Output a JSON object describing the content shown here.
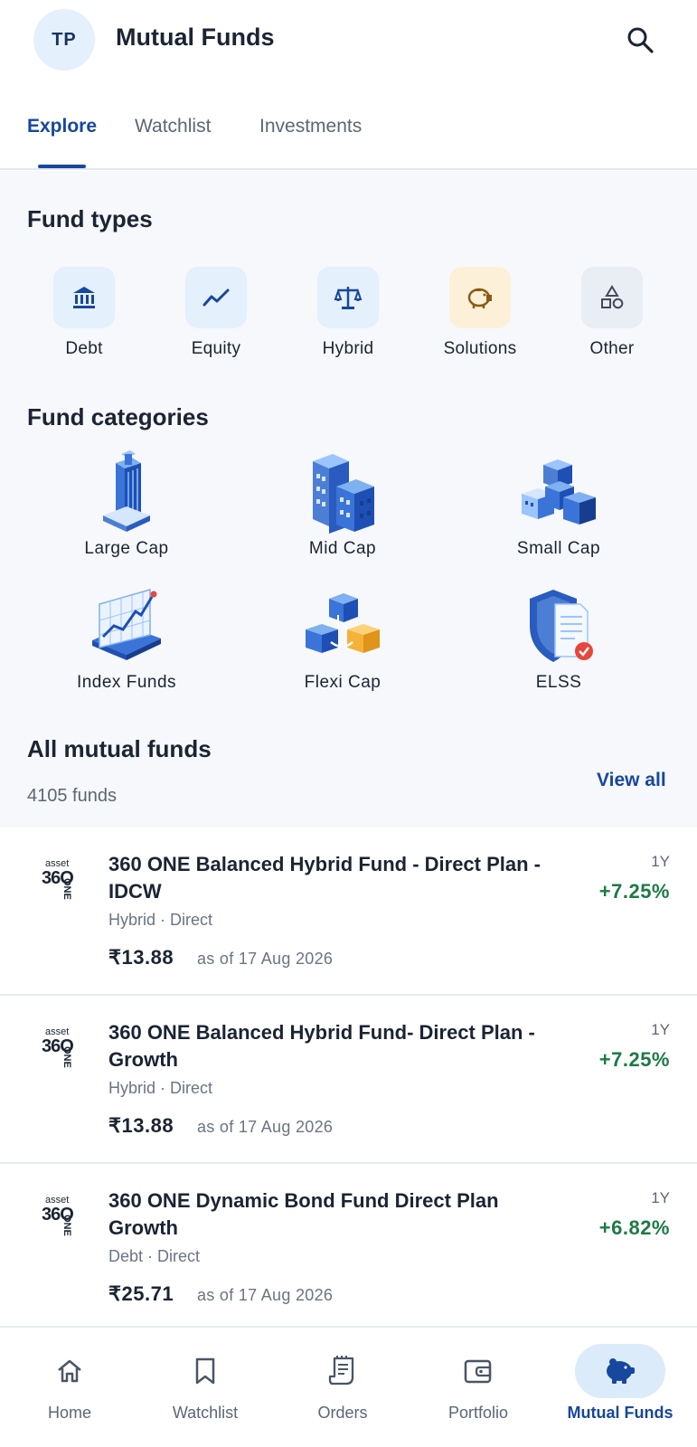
{
  "header": {
    "avatar_initials": "TP",
    "title": "Mutual Funds",
    "search_icon": "search-icon"
  },
  "tabs": [
    {
      "label": "Explore",
      "active": true
    },
    {
      "label": "Watchlist",
      "active": false
    },
    {
      "label": "Investments",
      "active": false
    }
  ],
  "fund_types": {
    "title": "Fund types",
    "items": [
      {
        "label": "Debt",
        "icon": "bank-icon",
        "bg": "#e4f0fc",
        "color": "#17479e"
      },
      {
        "label": "Equity",
        "icon": "trend-line-icon",
        "bg": "#e4f0fc",
        "color": "#17479e"
      },
      {
        "label": "Hybrid",
        "icon": "scales-icon",
        "bg": "#e4f0fc",
        "color": "#17479e"
      },
      {
        "label": "Solutions",
        "icon": "piggy-bank-icon",
        "bg": "#fdf0d8",
        "color": "#8a5a16"
      },
      {
        "label": "Other",
        "icon": "shapes-icon",
        "bg": "#e9edf4",
        "color": "#404a5a"
      }
    ]
  },
  "fund_categories": {
    "title": "Fund categories",
    "items": [
      {
        "label": "Large Cap",
        "icon": "skyscraper-icon"
      },
      {
        "label": "Mid Cap",
        "icon": "buildings-icon"
      },
      {
        "label": "Small Cap",
        "icon": "cubes-icon"
      },
      {
        "label": "Index Funds",
        "icon": "chart-board-icon"
      },
      {
        "label": "Flexi Cap",
        "icon": "connected-blocks-icon"
      },
      {
        "label": "ELSS",
        "icon": "shield-document-icon"
      }
    ]
  },
  "all_funds": {
    "title": "All mutual funds",
    "count": "4105 funds",
    "view_all": "View all",
    "items": [
      {
        "logo_top": "asset",
        "logo_main": "36O",
        "logo_side": "ONE",
        "name": "360 ONE Balanced Hybrid Fund - Direct Plan - IDCW",
        "meta": "Hybrid · Direct",
        "price": "₹13.88",
        "as_of": "as of 17 Aug 2026",
        "period": "1Y",
        "return": "+7.25%"
      },
      {
        "logo_top": "asset",
        "logo_main": "36O",
        "logo_side": "ONE",
        "name": "360 ONE Balanced Hybrid Fund- Direct Plan - Growth",
        "meta": "Hybrid · Direct",
        "price": "₹13.88",
        "as_of": "as of 17 Aug 2026",
        "period": "1Y",
        "return": "+7.25%"
      },
      {
        "logo_top": "asset",
        "logo_main": "36O",
        "logo_side": "ONE",
        "name": "360 ONE Dynamic Bond Fund Direct Plan Growth",
        "meta": "Debt · Direct",
        "price": "₹25.71",
        "as_of": "as of 17 Aug 2026",
        "period": "1Y",
        "return": "+6.82%"
      }
    ]
  },
  "bottom_nav": [
    {
      "label": "Home",
      "icon": "home-icon",
      "active": false
    },
    {
      "label": "Watchlist",
      "icon": "bookmark-icon",
      "active": false
    },
    {
      "label": "Orders",
      "icon": "receipt-icon",
      "active": false
    },
    {
      "label": "Portfolio",
      "icon": "wallet-icon",
      "active": false
    },
    {
      "label": "Mutual Funds",
      "icon": "piggy-bank-icon",
      "active": true
    }
  ],
  "colors": {
    "accent": "#17479e",
    "positive": "#1c7a45",
    "section_bg": "#f6f8fb"
  }
}
